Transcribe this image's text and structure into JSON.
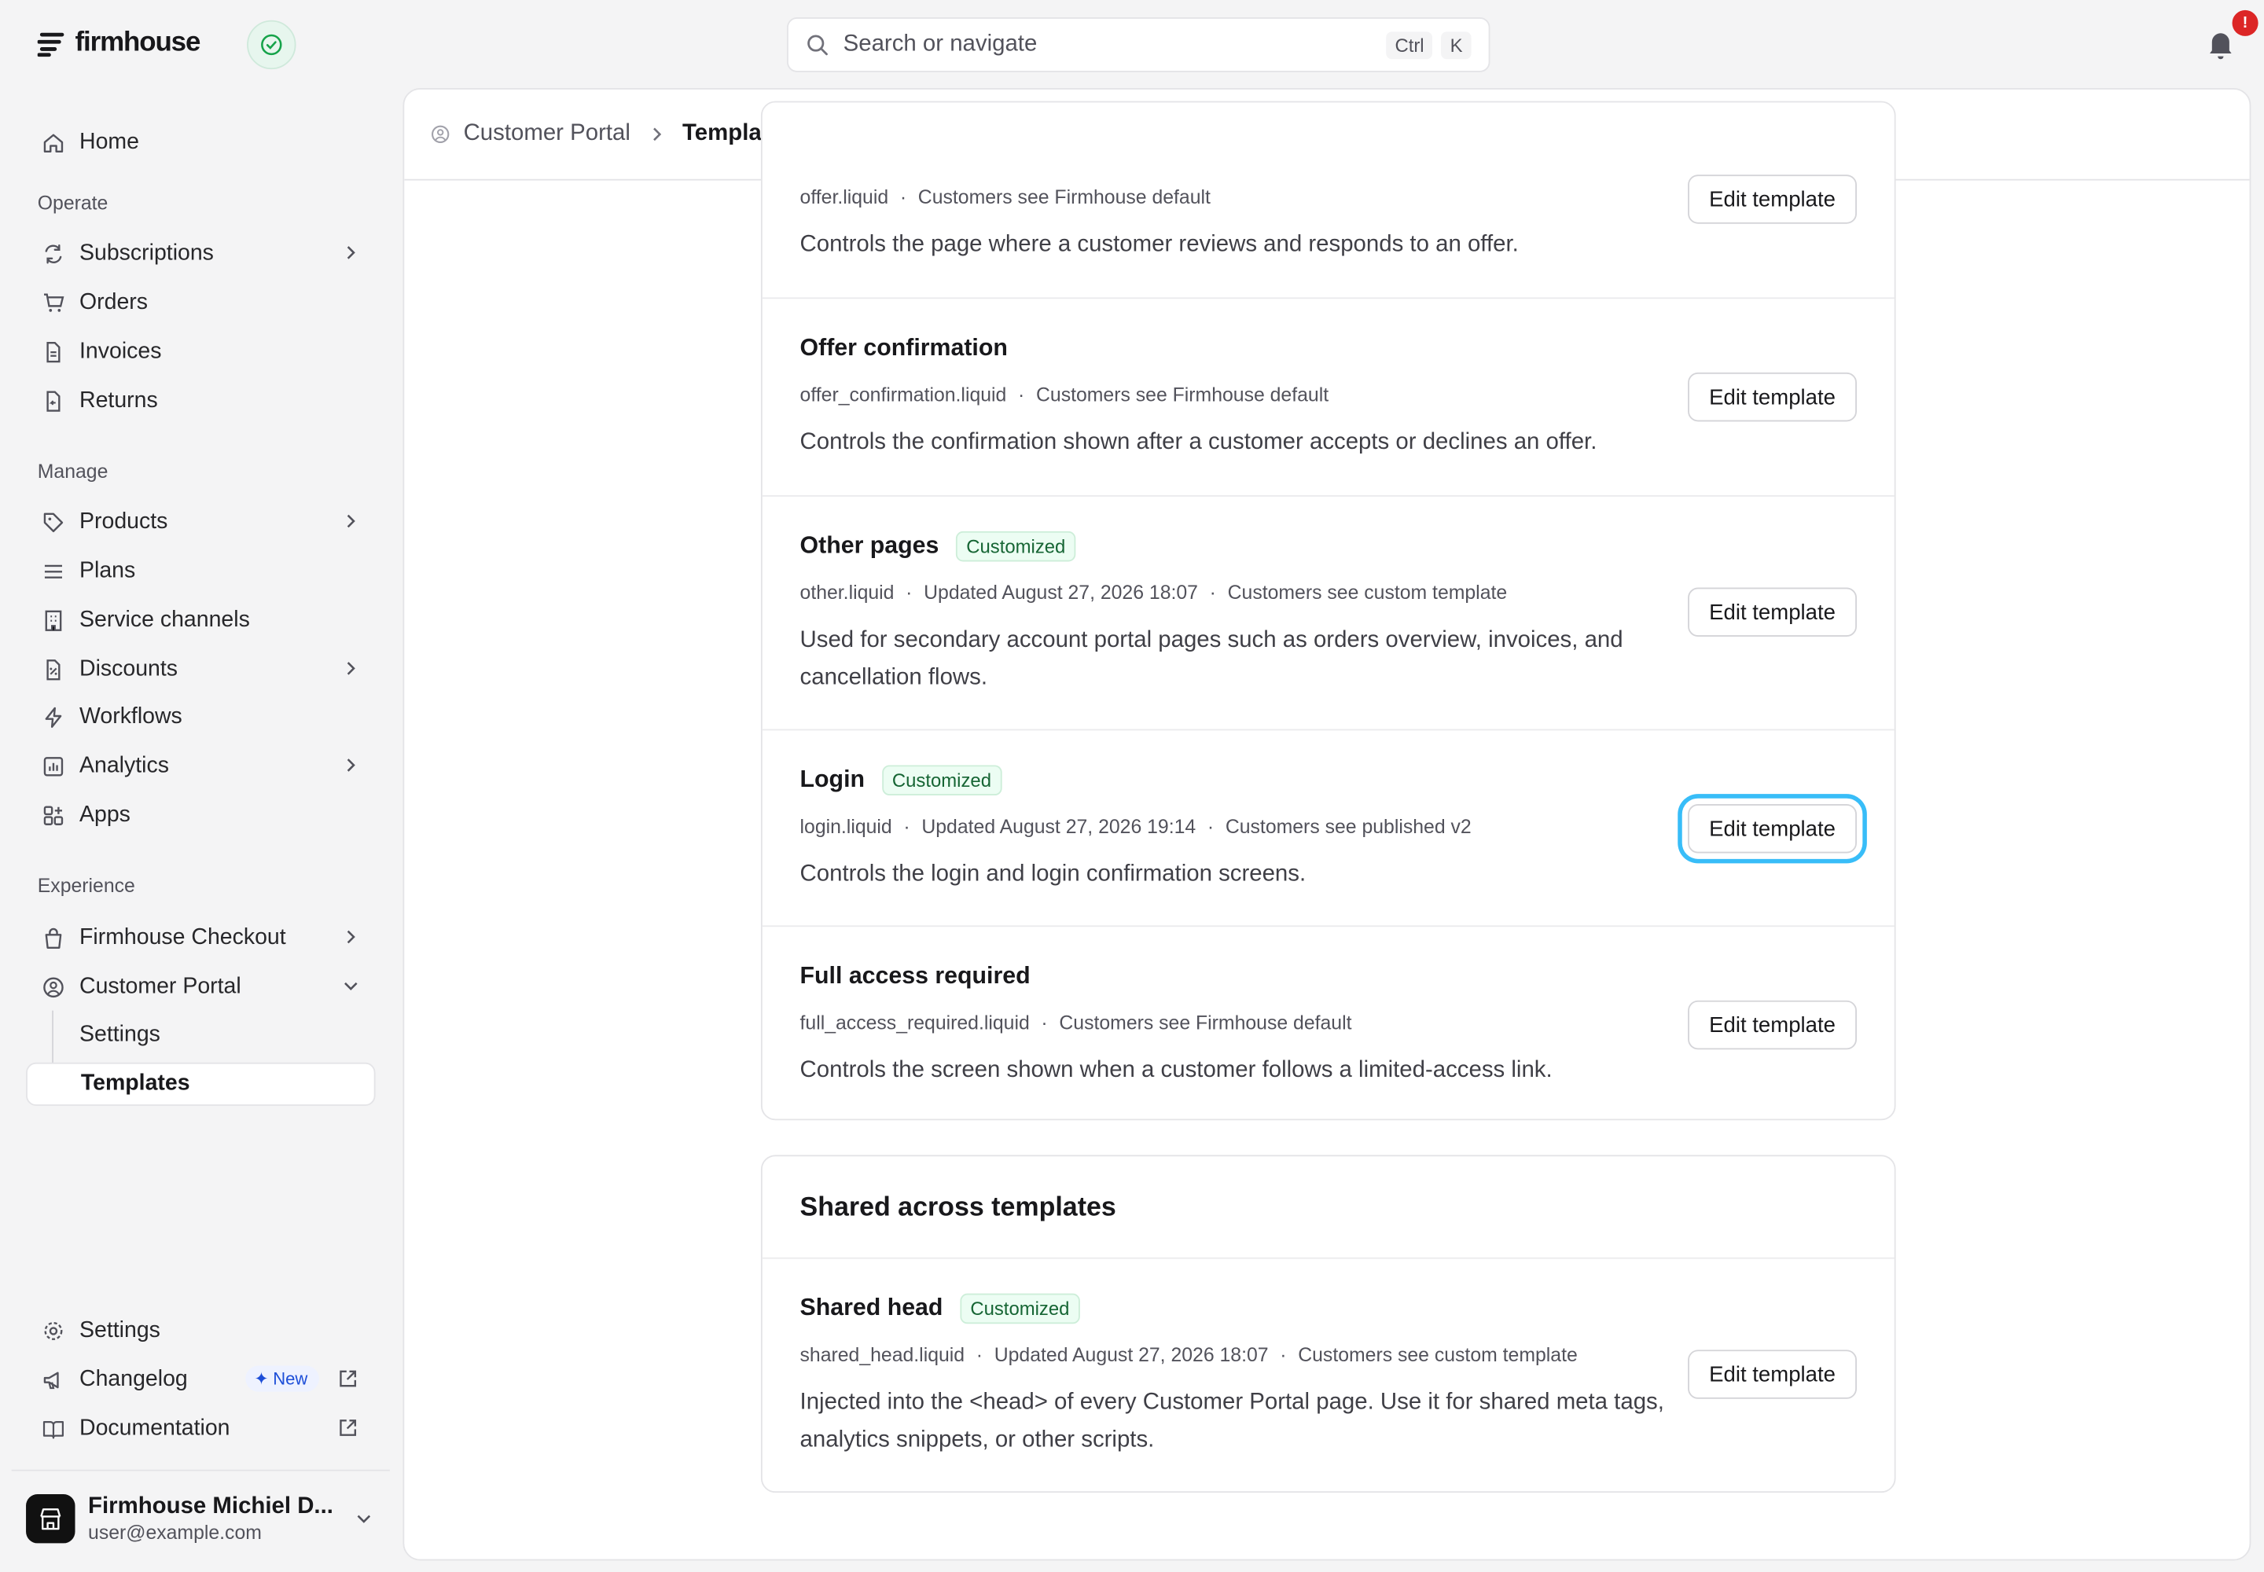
{
  "app": {
    "logo_text": "firmhouse"
  },
  "search": {
    "placeholder": "Search or navigate",
    "kbd_1": "Ctrl",
    "kbd_2": "K"
  },
  "notifications": {
    "badge": "!"
  },
  "sidebar": {
    "home": "Home",
    "section_operate": "Operate",
    "subscriptions": "Subscriptions",
    "orders": "Orders",
    "invoices": "Invoices",
    "returns": "Returns",
    "section_manage": "Manage",
    "products": "Products",
    "plans": "Plans",
    "service_channels": "Service channels",
    "discounts": "Discounts",
    "workflows": "Workflows",
    "analytics": "Analytics",
    "apps": "Apps",
    "section_experience": "Experience",
    "checkout": "Firmhouse Checkout",
    "customer_portal": "Customer Portal",
    "cp_settings": "Settings",
    "cp_templates": "Templates",
    "settings": "Settings",
    "changelog": "Changelog",
    "new_badge": "New",
    "documentation": "Documentation"
  },
  "account": {
    "name": "Firmhouse Michiel D...",
    "email": "user@example.com"
  },
  "breadcrumb": {
    "parent": "Customer Portal",
    "current": "Templates"
  },
  "templates": [
    {
      "title": "",
      "file": "offer.liquid",
      "updated": "",
      "visibility": "Customers see Firmhouse default",
      "description": "Controls the page where a customer reviews and responds to an offer.",
      "button": "Edit template"
    },
    {
      "title": "Offer confirmation",
      "file": "offer_confirmation.liquid",
      "updated": "",
      "visibility": "Customers see Firmhouse default",
      "description": "Controls the confirmation shown after a customer accepts or declines an offer.",
      "button": "Edit template"
    },
    {
      "title": "Other pages",
      "badge": "Customized",
      "file": "other.liquid",
      "updated": "Updated August 27, 2026 18:07",
      "visibility": "Customers see custom template",
      "description": "Used for secondary account portal pages such as orders overview, invoices, and cancellation flows.",
      "button": "Edit template"
    },
    {
      "title": "Login",
      "badge": "Customized",
      "file": "login.liquid",
      "updated": "Updated August 27, 2026 19:14",
      "visibility": "Customers see published v2",
      "description": "Controls the login and login confirmation screens.",
      "button": "Edit template"
    },
    {
      "title": "Full access required",
      "file": "full_access_required.liquid",
      "updated": "",
      "visibility": "Customers see Firmhouse default",
      "description": "Controls the screen shown when a customer follows a limited-access link.",
      "button": "Edit template"
    }
  ],
  "shared": {
    "heading": "Shared across templates",
    "item": {
      "title": "Shared head",
      "badge": "Customized",
      "file": "shared_head.liquid",
      "updated": "Updated August 27, 2026 18:07",
      "visibility": "Customers see custom template",
      "description": "Injected into the <head> of every Customer Portal page. Use it for shared meta tags, analytics snippets, or other scripts.",
      "button": "Edit template"
    }
  },
  "colors": {
    "accent_focus": "#38bdf8",
    "badge_green": "#166534",
    "alert_red": "#dc2626"
  }
}
